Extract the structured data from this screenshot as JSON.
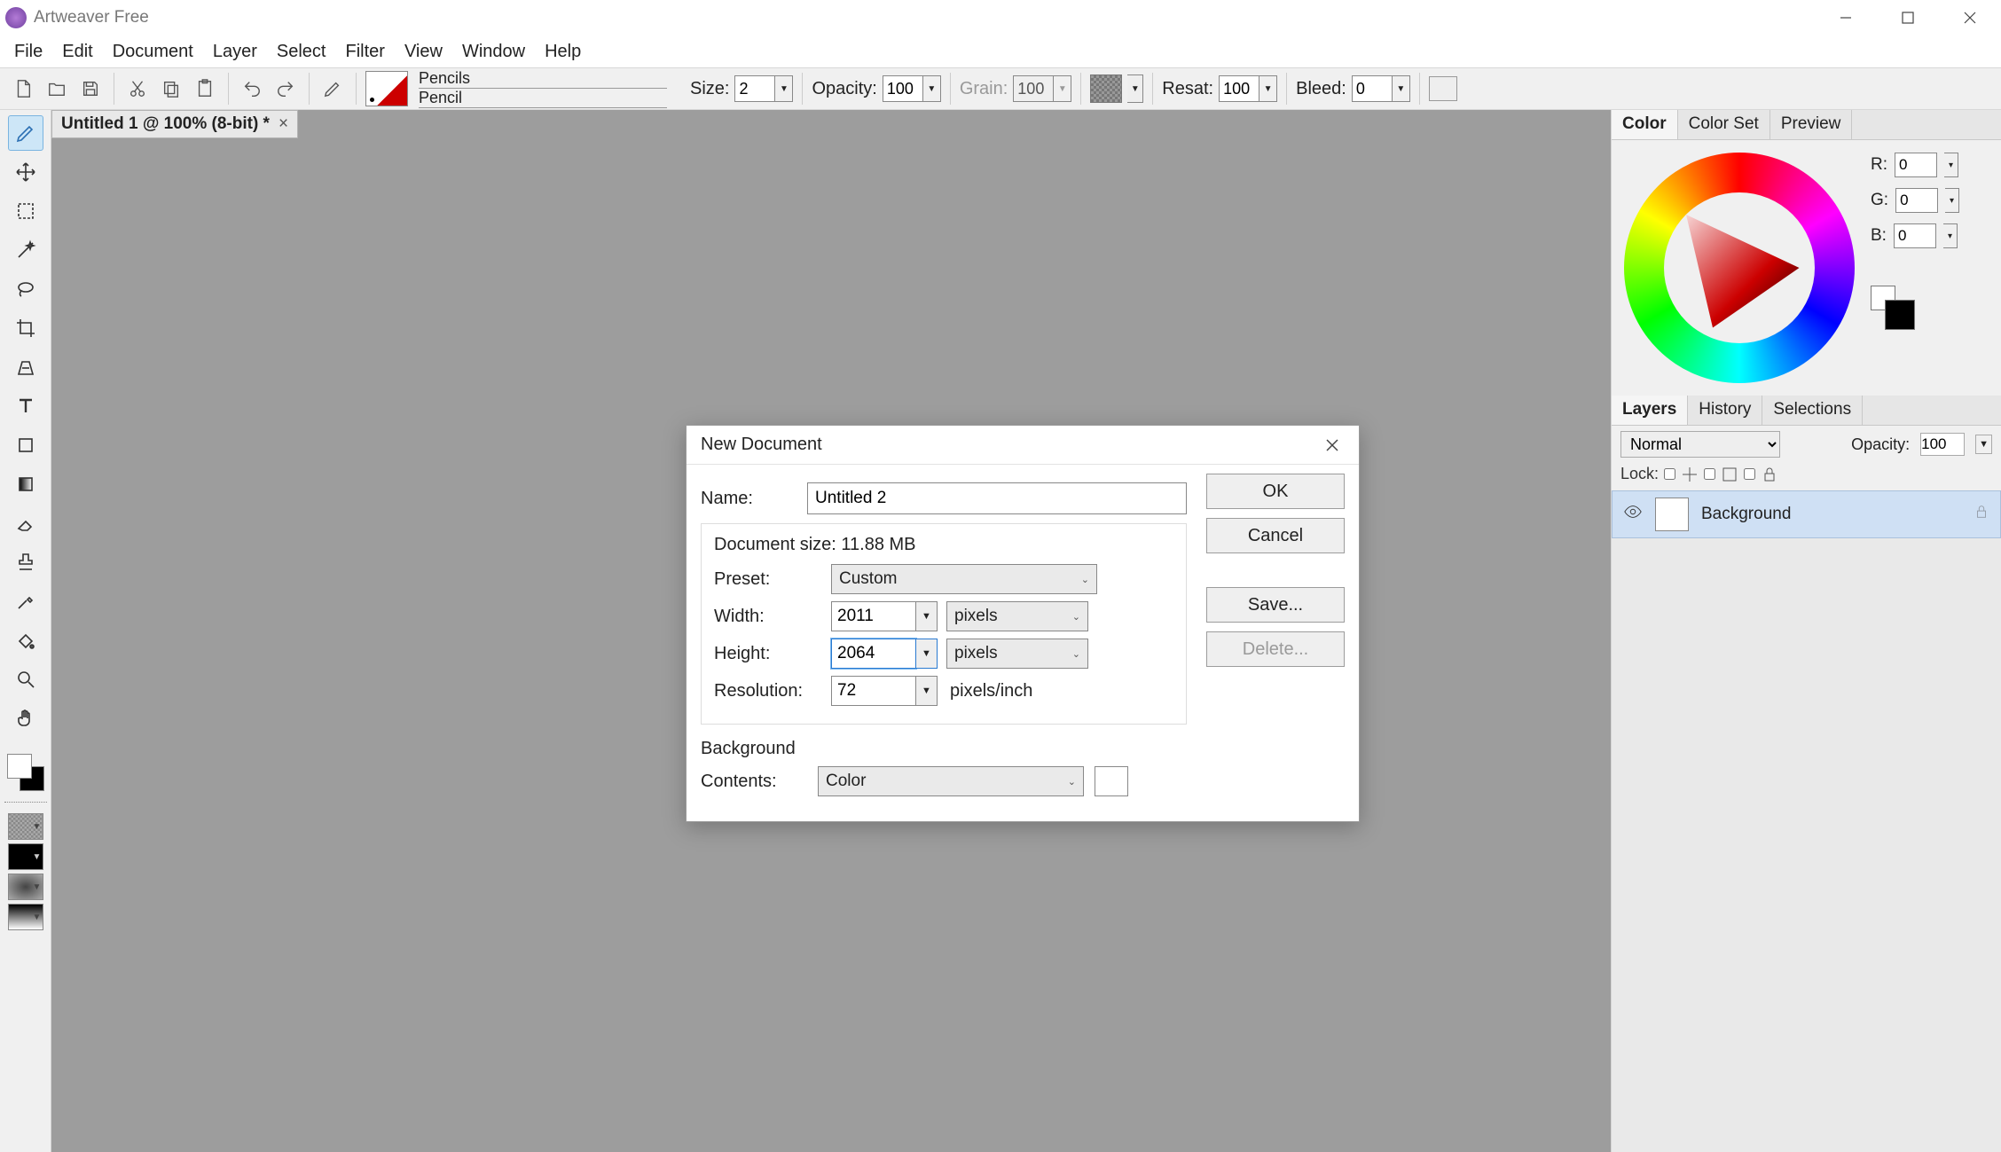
{
  "app": {
    "title": "Artweaver Free"
  },
  "menu": [
    "File",
    "Edit",
    "Document",
    "Layer",
    "Select",
    "Filter",
    "View",
    "Window",
    "Help"
  ],
  "options": {
    "brush_group": "Pencils",
    "brush_name": "Pencil",
    "size_label": "Size:",
    "size": "2",
    "opacity_label": "Opacity:",
    "opacity": "100",
    "grain_label": "Grain:",
    "grain": "100",
    "resat_label": "Resat:",
    "resat": "100",
    "bleed_label": "Bleed:",
    "bleed": "0"
  },
  "doc_tab": {
    "title": "Untitled 1 @ 100% (8-bit) *"
  },
  "color_panel": {
    "tabs": [
      "Color",
      "Color Set",
      "Preview"
    ],
    "r_label": "R:",
    "r": "0",
    "g_label": "G:",
    "g": "0",
    "b_label": "B:",
    "b": "0"
  },
  "layers_panel": {
    "tabs": [
      "Layers",
      "History",
      "Selections"
    ],
    "blend": "Normal",
    "opacity_label": "Opacity:",
    "opacity": "100",
    "lock_label": "Lock:",
    "layer_name": "Background"
  },
  "dialog": {
    "title": "New Document",
    "name_label": "Name:",
    "name": "Untitled 2",
    "docsize_label": "Document size: 11.88 MB",
    "preset_label": "Preset:",
    "preset": "Custom",
    "width_label": "Width:",
    "width": "2011",
    "width_unit": "pixels",
    "height_label": "Height:",
    "height": "2064",
    "height_unit": "pixels",
    "res_label": "Resolution:",
    "res": "72",
    "res_unit": "pixels/inch",
    "bg_label": "Background",
    "contents_label": "Contents:",
    "contents": "Color",
    "btn_ok": "OK",
    "btn_cancel": "Cancel",
    "btn_save": "Save...",
    "btn_delete": "Delete..."
  }
}
